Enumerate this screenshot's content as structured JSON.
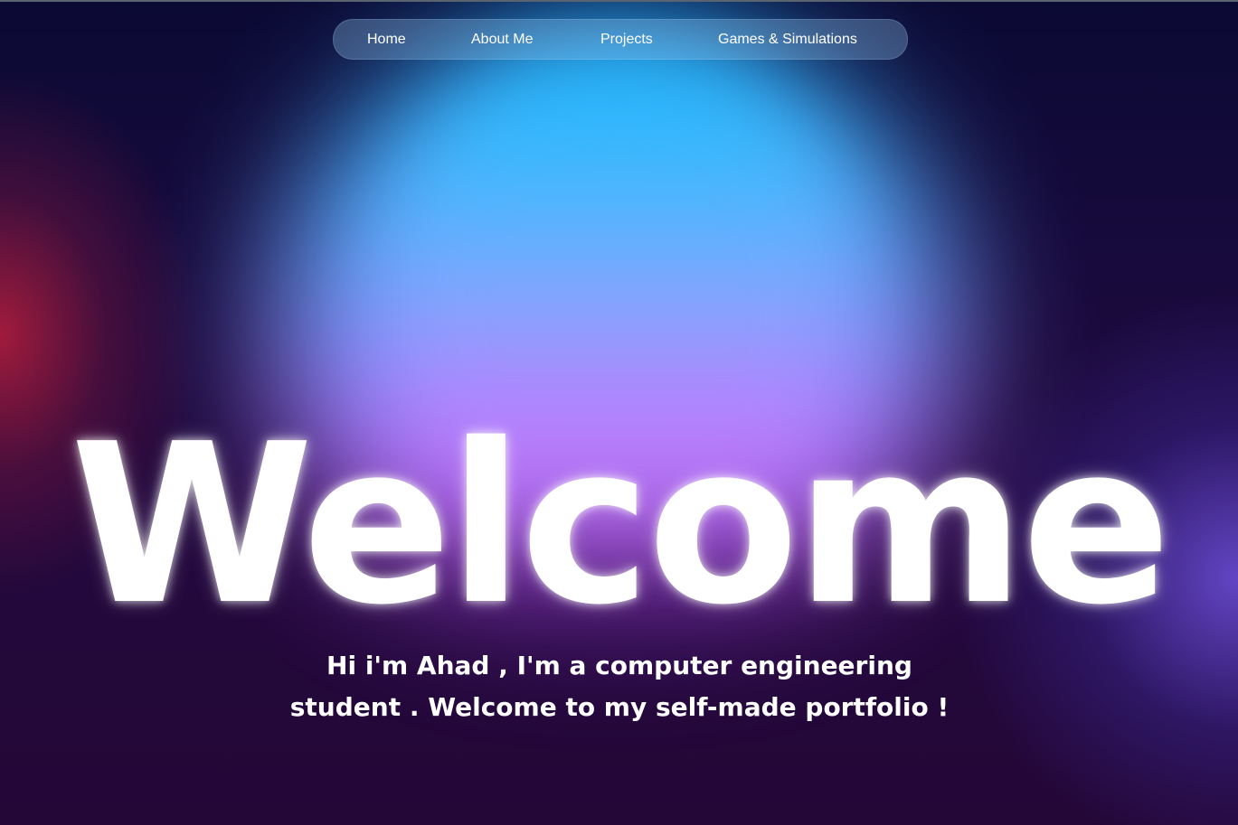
{
  "nav": {
    "items": [
      {
        "label": "Home"
      },
      {
        "label": "About Me"
      },
      {
        "label": "Projects"
      },
      {
        "label": "Games & Simulations"
      }
    ]
  },
  "hero": {
    "headline": "Welcome",
    "intro": "Hi i'm Ahad , I'm a computer engineering student . Welcome to my self-made portfolio !"
  },
  "colors": {
    "background": "#1c0836",
    "glow_top": "#1fb4ff",
    "glow_bottom": "#c063ee",
    "text": "#ffffff",
    "nav_background": "rgba(150,200,240,0.32)"
  }
}
